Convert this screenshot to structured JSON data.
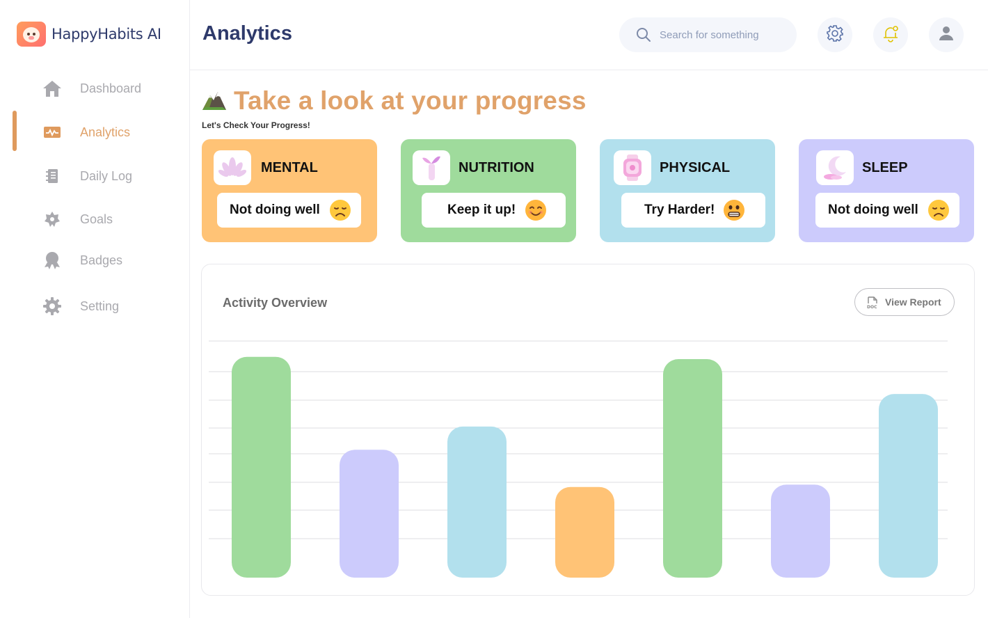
{
  "brand": {
    "name": "HappyHabits AI"
  },
  "sidebar": {
    "items": [
      {
        "label": "Dashboard",
        "icon": "home-icon",
        "active": false
      },
      {
        "label": "Analytics",
        "icon": "activity-icon",
        "active": true
      },
      {
        "label": "Daily Log",
        "icon": "notebook-icon",
        "active": false
      },
      {
        "label": "Goals",
        "icon": "star-badge-icon",
        "active": false
      },
      {
        "label": "Badges",
        "icon": "award-icon",
        "active": false
      },
      {
        "label": "Setting",
        "icon": "gear-icon",
        "active": false
      }
    ]
  },
  "header": {
    "title": "Analytics",
    "search_placeholder": "Search for something",
    "icons": [
      "settings-icon",
      "notification-bell-icon",
      "user-avatar-icon"
    ]
  },
  "hero": {
    "title": "Take a look at your progress",
    "subtitle": "Let's Check Your Progress!",
    "icon": "mountain-icon"
  },
  "cards": [
    {
      "title": "MENTAL",
      "status": "Not doing well",
      "emoji": "sad-face-emoji",
      "color": "#ffc376",
      "icon": "lotus-icon"
    },
    {
      "title": "NUTRITION",
      "status": "Keep it up!",
      "emoji": "smiling-face-emoji",
      "color": "#9fdb9c",
      "icon": "sprout-icon"
    },
    {
      "title": "PHYSICAL",
      "status": "Try Harder!",
      "emoji": "grimace-face-emoji",
      "color": "#b2e0ed",
      "icon": "smartwatch-icon"
    },
    {
      "title": "SLEEP",
      "status": "Not doing well",
      "emoji": "sad-face-emoji",
      "color": "#cccbfc",
      "icon": "moon-icon"
    }
  ],
  "panel": {
    "title": "Activity Overview",
    "view_report_label": "View Report"
  },
  "chart_data": {
    "type": "bar",
    "title": "",
    "xlabel": "",
    "ylabel": "",
    "grid": true,
    "ylim": [
      0,
      100
    ],
    "values": [
      95,
      55,
      65,
      39,
      94,
      40,
      79
    ],
    "colors": [
      "#9fdb9c",
      "#cccbfc",
      "#b2e0ed",
      "#ffc376",
      "#9fdb9c",
      "#cccbfc",
      "#b2e0ed"
    ]
  },
  "colors": {
    "accent": "#df9a5d",
    "title": "#2e3a6b",
    "muted": "#a9a9ae"
  }
}
